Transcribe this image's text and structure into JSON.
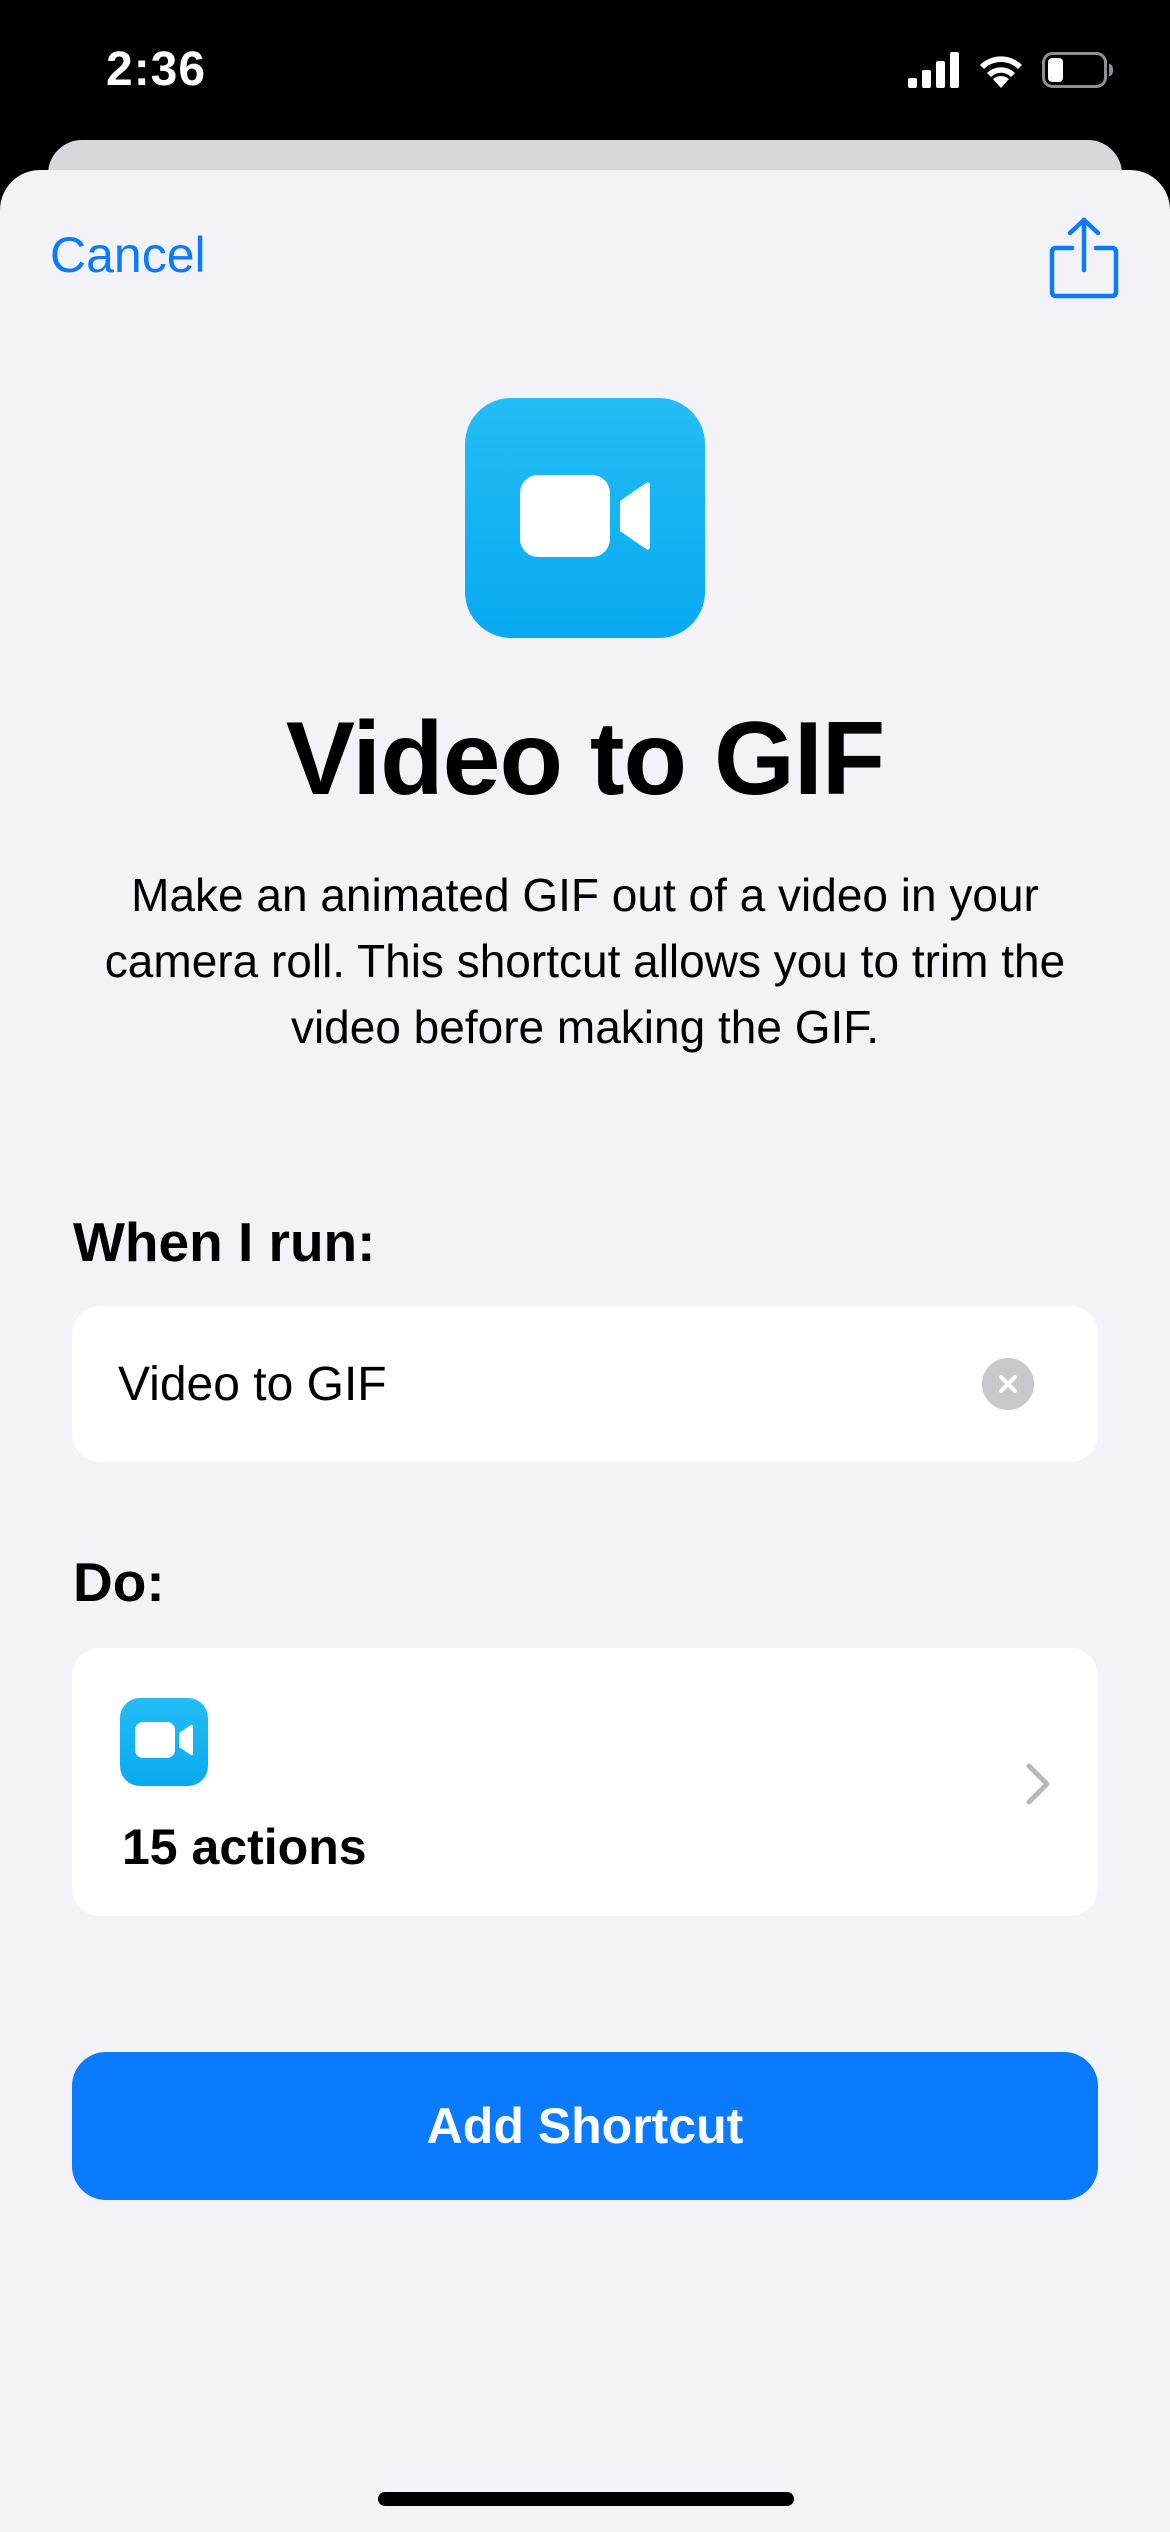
{
  "status_bar": {
    "time": "2:36",
    "icons": [
      "cellular-signal-icon",
      "wifi-icon",
      "battery-icon"
    ]
  },
  "header": {
    "cancel_label": "Cancel",
    "share_icon": "share-icon"
  },
  "shortcut": {
    "icon": "video-camera-icon",
    "title": "Video to GIF",
    "description": "Make an animated GIF out of a video in your camera roll. This shortcut allows you to trim the video before making the GIF."
  },
  "when_run": {
    "label": "When I run:",
    "value": "Video to GIF",
    "clear_icon": "clear-icon"
  },
  "do_section": {
    "label": "Do:",
    "icon": "video-camera-icon",
    "actions_text": "15 actions",
    "chevron_icon": "chevron-right-icon"
  },
  "add_button_label": "Add Shortcut",
  "colors": {
    "accent": "#0a7aff",
    "icon_blue": "#0fb0f2",
    "sheet_background": "#f2f2f7",
    "card_background": "#ffffff"
  }
}
